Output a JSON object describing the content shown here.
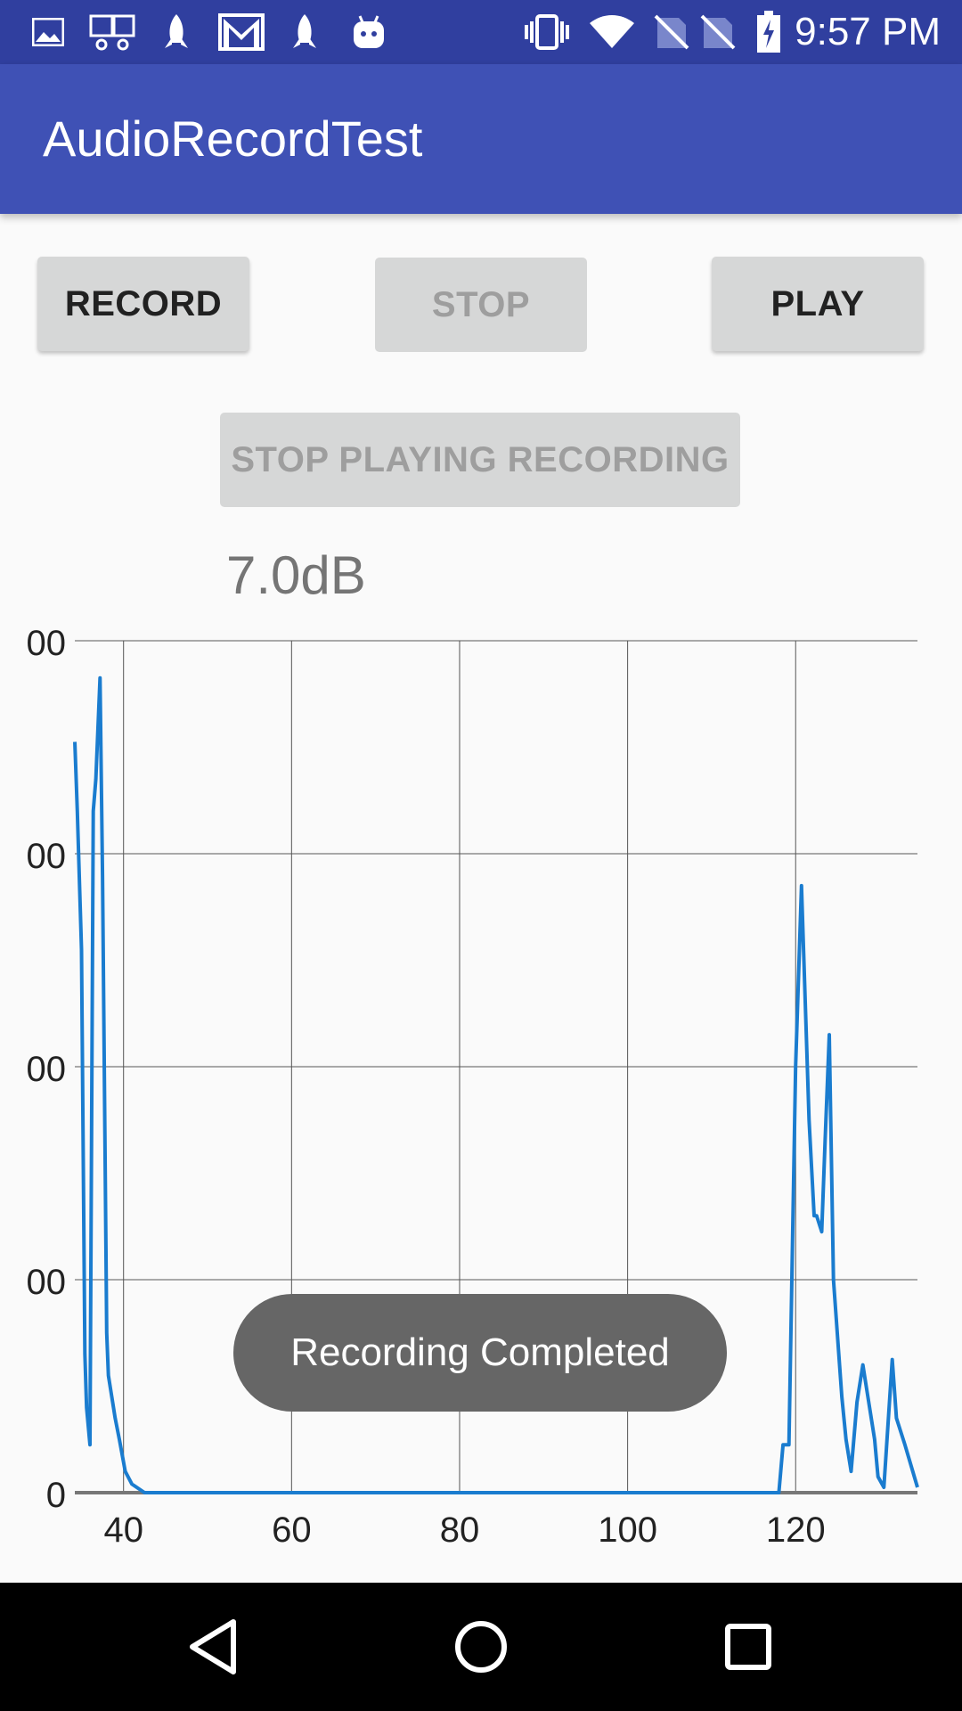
{
  "status_bar": {
    "time": "9:57 PM",
    "left_icons": [
      "image-icon",
      "calendar-icon",
      "rocket-icon",
      "gmail-icon",
      "rocket-icon",
      "android-icon"
    ],
    "right_icons": [
      "vibrate-icon",
      "wifi-icon",
      "no-sim-icon",
      "no-sim-icon",
      "battery-charging-icon"
    ]
  },
  "app_bar": {
    "title": "AudioRecordTest"
  },
  "buttons": {
    "record": "RECORD",
    "stop": "STOP",
    "play": "PLAY",
    "stop_playing": "STOP PLAYING RECORDING"
  },
  "level_text": "7.0dB",
  "toast": {
    "text": "Recording Completed"
  },
  "colors": {
    "primary": "#3f51b5",
    "primary_dark": "#303f9f",
    "line": "#1a7ccf"
  },
  "chart_data": {
    "type": "line",
    "title": "",
    "xlabel": "",
    "ylabel": "",
    "x_ticks": [
      "40",
      "60",
      "80",
      "100",
      "120"
    ],
    "y_ticks": [
      "0",
      "00",
      "00",
      "00",
      "00"
    ],
    "xlim": [
      34.2,
      134.5
    ],
    "ylim": [
      0,
      800
    ],
    "grid": true,
    "series": [
      {
        "x": [
          34.2,
          34.5,
          35.0,
          35.4,
          35.6,
          36.0,
          36.4,
          36.7,
          37.2,
          37.5,
          38.0,
          38.2,
          39.0,
          39.5,
          40.2,
          41.0,
          42.5,
          115.0,
          116.0,
          117.0,
          118.0,
          118.5,
          119.2,
          120.0,
          120.7,
          121.6,
          122.2,
          122.5,
          123.1,
          123.5,
          124.0,
          124.5,
          125.5,
          126.0,
          126.6,
          127.3,
          128.0,
          128.5,
          129.4,
          129.8,
          130.5,
          131.5,
          132.0,
          133.0,
          134.5
        ],
        "y": [
          705,
          640,
          510,
          130,
          80,
          45,
          640,
          670,
          765,
          580,
          150,
          110,
          70,
          50,
          20,
          8,
          0,
          0,
          0,
          0,
          0,
          45,
          45,
          400,
          570,
          350,
          260,
          260,
          245,
          330,
          430,
          200,
          90,
          50,
          20,
          85,
          120,
          95,
          50,
          15,
          5,
          125,
          70,
          45,
          5
        ]
      }
    ]
  }
}
